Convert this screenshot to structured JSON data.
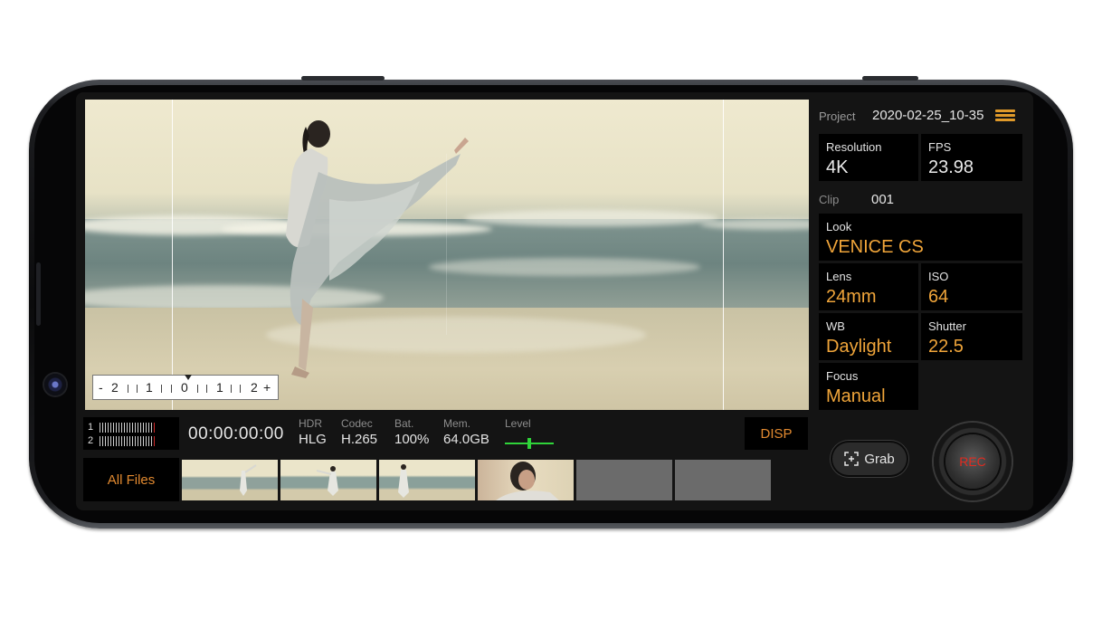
{
  "project": {
    "label": "Project",
    "value": "2020-02-25_10-35"
  },
  "settings": {
    "resolution": {
      "label": "Resolution",
      "value": "4K"
    },
    "fps": {
      "label": "FPS",
      "value": "23.98"
    },
    "look": {
      "label": "Look",
      "value": "VENICE CS"
    },
    "lens": {
      "label": "Lens",
      "value": "24mm"
    },
    "iso": {
      "label": "ISO",
      "value": "64"
    },
    "wb": {
      "label": "WB",
      "value": "Daylight"
    },
    "shutter": {
      "label": "Shutter",
      "value": "22.5"
    },
    "focus": {
      "label": "Focus",
      "value": "Manual"
    }
  },
  "clip": {
    "label": "Clip",
    "value": "001"
  },
  "exposure_scale": {
    "labels": [
      "-",
      "2",
      "1",
      "0",
      "1",
      "2",
      "+"
    ]
  },
  "audio_meter": {
    "channels": [
      "1",
      "2"
    ]
  },
  "status": {
    "timecode": "00:00:00:00",
    "hdr": {
      "label": "HDR",
      "value": "HLG"
    },
    "codec": {
      "label": "Codec",
      "value": "H.265"
    },
    "battery": {
      "label": "Bat.",
      "value": "100%"
    },
    "memory": {
      "label": "Mem.",
      "value": "64.0GB"
    },
    "level": {
      "label": "Level"
    }
  },
  "buttons": {
    "disp": "DISP",
    "all_files": "All Files",
    "grab": "Grab",
    "rec": "REC"
  },
  "colors": {
    "accent": "#f0a53a",
    "rec": "#e02b20",
    "level": "#2fd43a"
  },
  "icons": [
    "menu-icon",
    "grab-icon",
    "level-icon"
  ]
}
